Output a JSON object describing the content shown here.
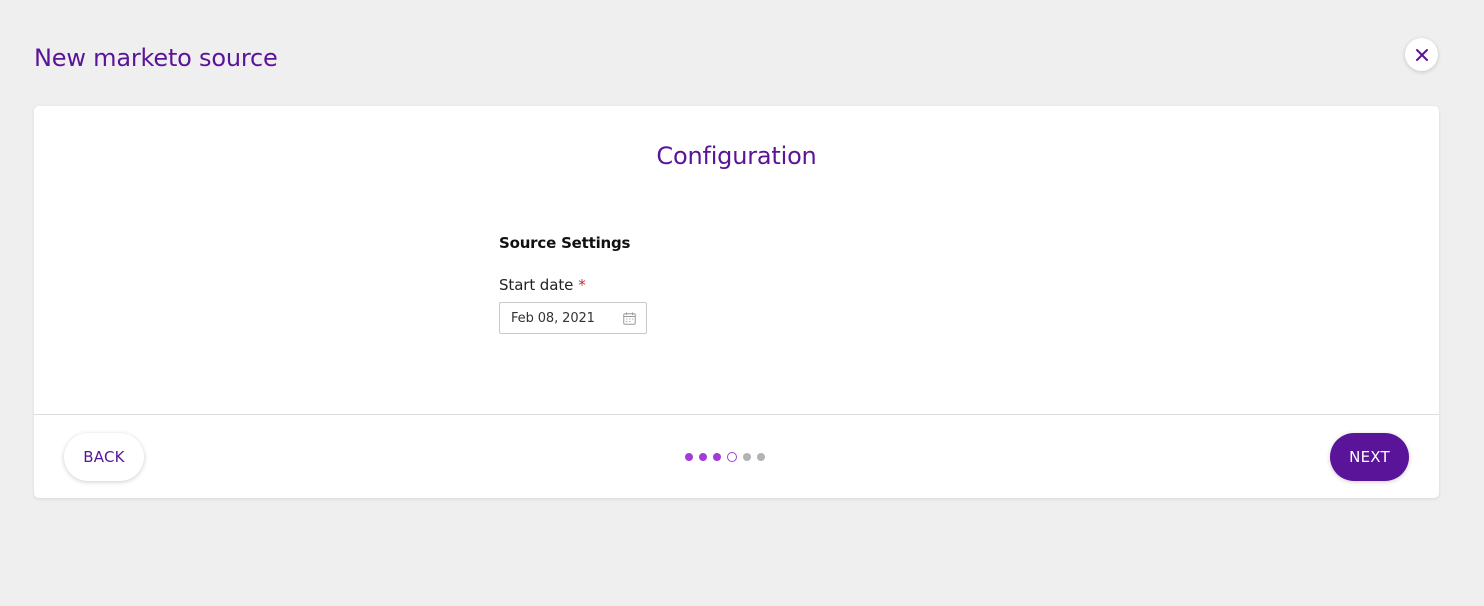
{
  "header": {
    "title": "New marketo source",
    "close_icon": "close-icon"
  },
  "card": {
    "title": "Configuration",
    "section_heading": "Source Settings",
    "start_date": {
      "label": "Start date",
      "required_marker": "*",
      "value": "Feb 08, 2021",
      "icon": "calendar-icon"
    }
  },
  "footer": {
    "back_label": "BACK",
    "next_label": "NEXT",
    "steps": [
      "done",
      "done",
      "done",
      "current",
      "pending",
      "pending"
    ]
  },
  "colors": {
    "brand": "#5a1499",
    "step_active": "#a43bd6",
    "step_pending": "#b3b3b3",
    "required": "#d42828",
    "background": "#efefef"
  }
}
